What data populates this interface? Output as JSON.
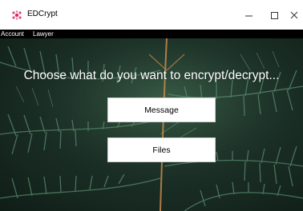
{
  "window": {
    "title": "EDCrypt",
    "minimize_glyph": "—",
    "maximize_glyph": "☐",
    "close_glyph": "✕"
  },
  "menu": {
    "items": [
      {
        "label": "Account"
      },
      {
        "label": "Lawyer"
      }
    ]
  },
  "main": {
    "prompt": "Choose what do you want to encrypt/decrypt...",
    "buttons": {
      "message": "Message",
      "files": "Files"
    }
  },
  "colors": {
    "menubar": "#000000",
    "background_dark": "#1c3128",
    "fern_green": "#3d6b52",
    "fern_stem": "#c98a4a"
  }
}
